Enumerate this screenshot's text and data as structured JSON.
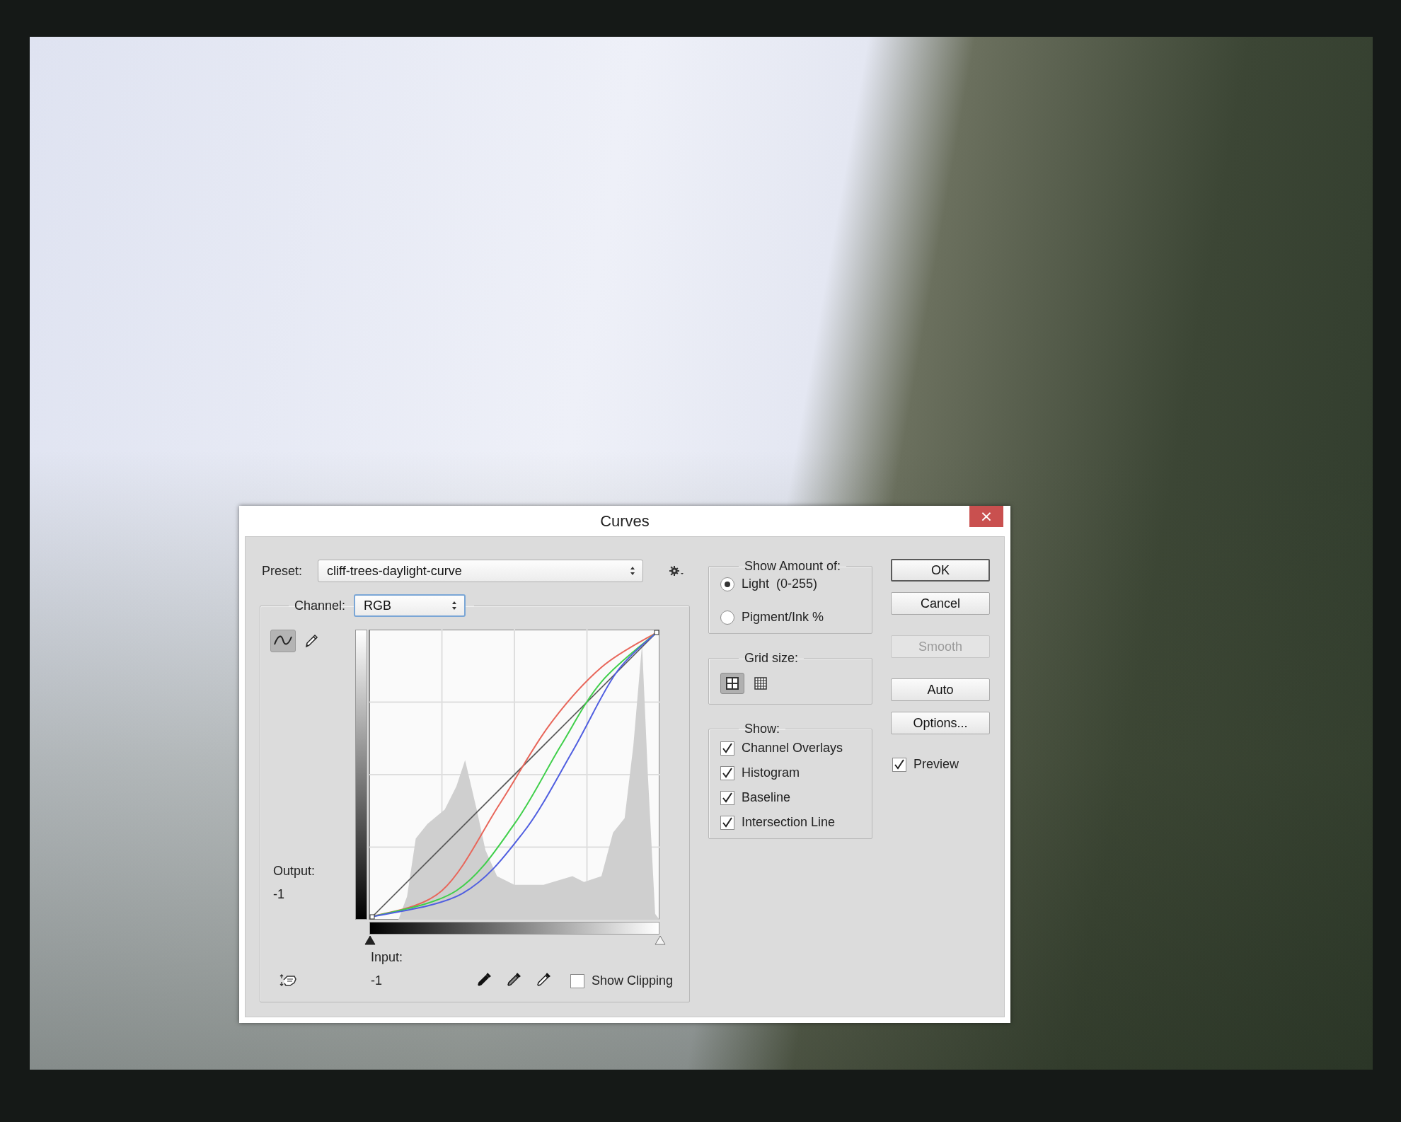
{
  "window": {
    "title": "Curves",
    "close": "×"
  },
  "preset": {
    "label": "Preset:",
    "value": "cliff-trees-daylight-curve"
  },
  "channel": {
    "label": "Channel:",
    "value": "RGB"
  },
  "curve_tools": [
    {
      "kind": "curve",
      "selected": true
    },
    {
      "kind": "pencil",
      "selected": false
    }
  ],
  "output": {
    "label": "Output:",
    "value": "-1"
  },
  "input": {
    "label": "Input:",
    "value": "-1"
  },
  "input_sliders": [
    {
      "kind": "shadow",
      "level": 0
    },
    {
      "kind": "highlight",
      "level": 1
    }
  ],
  "show_clipping": {
    "label": "Show Clipping",
    "checked": false
  },
  "show_amount": {
    "title": "Show Amount of:",
    "options": [
      {
        "label": "Light  (0-255)",
        "selected": true
      },
      {
        "label": "Pigment/Ink %",
        "selected": false
      }
    ]
  },
  "grid_size": {
    "title": "Grid size:",
    "options": [
      {
        "kind": "simple",
        "selected": true
      },
      {
        "kind": "detailed",
        "selected": false
      }
    ]
  },
  "show": {
    "title": "Show:",
    "options": [
      {
        "label": "Channel Overlays",
        "checked": true
      },
      {
        "label": "Histogram",
        "checked": true
      },
      {
        "label": "Baseline",
        "checked": true
      },
      {
        "label": "Intersection Line",
        "checked": true
      }
    ]
  },
  "buttons": [
    {
      "label": "OK",
      "default": true,
      "disabled": false
    },
    {
      "label": "Cancel",
      "default": false,
      "disabled": false
    },
    {
      "label": "Smooth",
      "default": false,
      "disabled": true
    },
    {
      "label": "Auto",
      "default": false,
      "disabled": false
    },
    {
      "label": "Options...",
      "default": false,
      "disabled": false
    }
  ],
  "preview": {
    "label": "Preview",
    "checked": true
  }
}
